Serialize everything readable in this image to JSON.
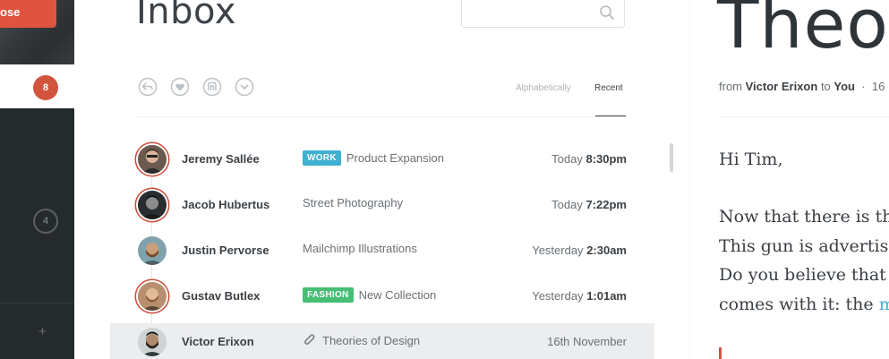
{
  "sidebar": {
    "compose_label": "ose",
    "unread_count": "8",
    "secondary_count": "4",
    "add_symbol": "+"
  },
  "inbox": {
    "title": "Inbox",
    "search_placeholder": "",
    "toolbar_icons": [
      "reply-icon",
      "heart-icon",
      "archive-icon",
      "more-icon"
    ],
    "sort": {
      "alphabetically": "Alphabetically",
      "recent": "Recent",
      "active": "Recent"
    },
    "messages": [
      {
        "sender": "Jeremy Sallée",
        "tag": "WORK",
        "subject": "Product Expansion",
        "day": "Today",
        "time": "8:30pm",
        "unread": true
      },
      {
        "sender": "Jacob Hubertus",
        "tag": "",
        "subject": "Street Photography",
        "day": "Today",
        "time": "7:22pm",
        "unread": true
      },
      {
        "sender": "Justin Pervorse",
        "tag": "",
        "subject": "Mailchimp Illustrations",
        "day": "Yesterday",
        "time": "2:30am",
        "unread": false
      },
      {
        "sender": "Gustav Butlex",
        "tag": "FASHION",
        "subject": "New Collection",
        "day": "Yesterday",
        "time": "1:01am",
        "unread": true
      },
      {
        "sender": "Victor Erixon",
        "tag": "",
        "subject": "Theories of Design",
        "day": "16th November",
        "time": "",
        "unread": false,
        "attachment": true,
        "selected": true
      }
    ]
  },
  "reader": {
    "title": "Theo",
    "from_label": "from",
    "from": "Victor Erixon",
    "to_label": "to",
    "to": "You",
    "sep": "·",
    "date_fragment": "16",
    "greeting": "Hi Tim,",
    "lines": [
      "Now that there is the",
      "This gun is advertise",
      "Do you believe that s",
      "comes with it: the "
    ],
    "link_fragment": "m"
  },
  "colors": {
    "accent_red": "#d2543f",
    "work_tag": "#3fb0d0",
    "fashion_tag": "#45bf74",
    "sidebar_dark": "#252a2d"
  }
}
